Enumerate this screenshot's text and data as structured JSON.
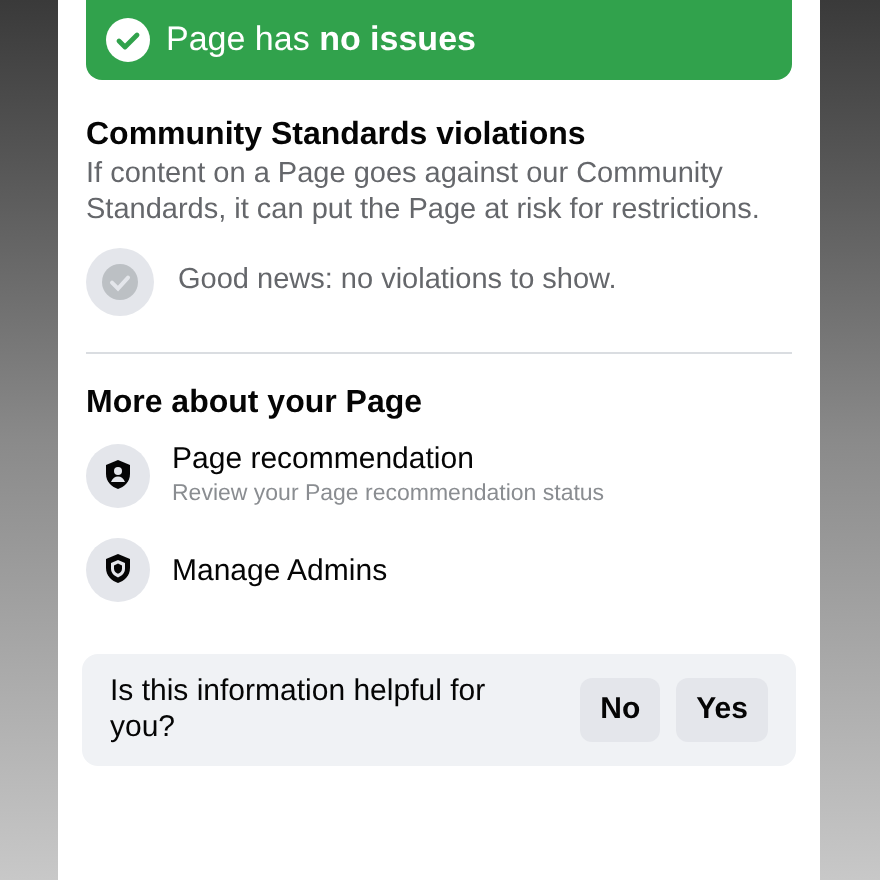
{
  "status_banner": {
    "text": "Page has **no issues**"
  },
  "violations": {
    "title": "Community Standards violations",
    "description": "If content on a Page goes against our Community Standards, it can put the Page at risk for restrictions.",
    "empty_message": "Good news: no violations to show."
  },
  "more": {
    "title": "More about your Page",
    "items": [
      {
        "kind": "recommendation",
        "label": "Page recommendation",
        "subtitle": "Review your Page recommendation status"
      },
      {
        "kind": "admins",
        "label": "Manage Admins"
      }
    ]
  },
  "feedback": {
    "question": "Is this information helpful for you?",
    "buttons": [
      "No",
      "Yes"
    ]
  }
}
